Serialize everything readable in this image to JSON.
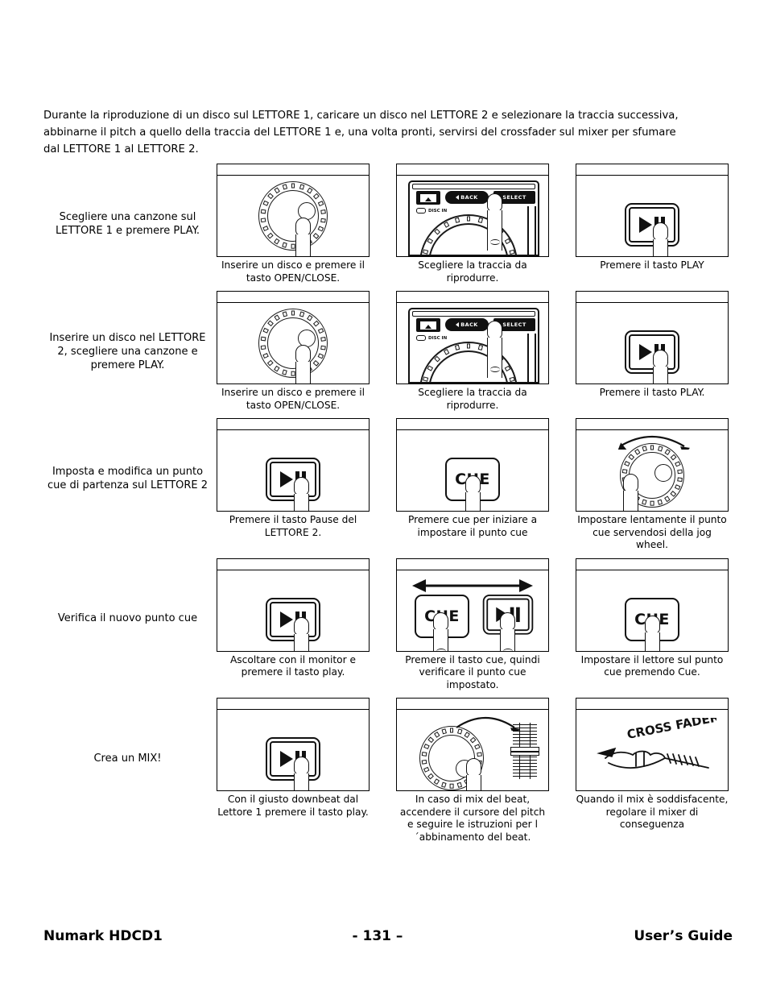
{
  "intro": "Durante la riproduzione di un disco sul LETTORE 1, caricare un disco nel LETTORE 2 e selezionare la traccia successiva, abbinarne il pitch a quello della traccia del LETTORE 1 e, una volta pronti, servirsi del crossfader sul mixer per sfumare dal LETTORE 1 al LETTORE 2.",
  "rows": [
    {
      "label": "Scegliere una canzone sul LETTORE 1 e premere PLAY.",
      "cells": [
        {
          "art": "jog-wheel-finger",
          "caption": "Inserire un disco e premere il tasto OPEN/CLOSE."
        },
        {
          "art": "control-panel-select",
          "caption": "Scegliere la traccia da riprodurre."
        },
        {
          "art": "play-button",
          "caption": "Premere il tasto PLAY"
        }
      ]
    },
    {
      "label": "Inserire un disco nel LETTORE 2, scegliere una canzone e premere PLAY.",
      "cells": [
        {
          "art": "jog-wheel-finger",
          "caption": "Inserire un disco e premere il tasto OPEN/CLOSE."
        },
        {
          "art": "control-panel-select",
          "caption": "Scegliere la traccia da riprodurre."
        },
        {
          "art": "play-button",
          "caption": "Premere il tasto PLAY."
        }
      ]
    },
    {
      "label": "Imposta e modifica un punto cue di partenza sul LETTORE 2",
      "cells": [
        {
          "art": "play-button",
          "caption": "Premere il tasto Pause del LETTORE 2."
        },
        {
          "art": "cue-button",
          "caption": "Premere cue per iniziare a impostare il punto cue"
        },
        {
          "art": "jog-wheel-bidirectional",
          "caption": "Impostare lentamente il punto cue servendosi della jog wheel."
        }
      ]
    },
    {
      "label": "Verifica il nuovo punto cue",
      "cells": [
        {
          "art": "play-button",
          "caption": "Ascoltare con il monitor e premere il tasto play."
        },
        {
          "art": "cue-play-arrow",
          "caption": "Premere il tasto cue, quindi verificare il punto cue impostato."
        },
        {
          "art": "cue-button",
          "caption": "Impostare il lettore sul punto cue premendo Cue."
        }
      ]
    },
    {
      "label": "Crea un MIX!",
      "cells": [
        {
          "art": "play-button",
          "caption": "Con il giusto downbeat dal Lettore 1 premere il tasto play."
        },
        {
          "art": "jog-wheel-pitch-fader",
          "caption": "In caso di mix del beat, accendere il cursore del pitch e seguire le istruzioni per l´abbinamento del beat."
        },
        {
          "art": "crossfader-sketch",
          "caption": "Quando il mix è soddisfacente, regolare il mixer di conseguenza"
        }
      ]
    }
  ],
  "panel": {
    "back_label": "BACK",
    "select_label": "SELECT",
    "disc_in_label": "DISC IN"
  },
  "buttons": {
    "cue_label": "CUE"
  },
  "sketch": {
    "text": "CROSS FADER"
  },
  "footer": {
    "left": "Numark HDCD1",
    "middle": "- 131 –",
    "right": "User’s Guide"
  },
  "colors": {
    "ink": "#000000",
    "paper": "#ffffff"
  }
}
